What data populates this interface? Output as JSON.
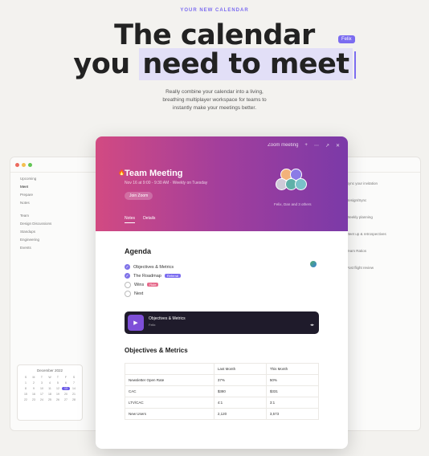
{
  "hero": {
    "eyebrow": "YOUR NEW CALENDAR",
    "line1": "The calendar",
    "line2_pre": "you",
    "line2_hl": "need to meet",
    "cursor_tag": "Felix",
    "sub": [
      "Really combine your calendar into a living,",
      "breathing multiplayer workspace for teams to",
      "instantly make your meetings better."
    ]
  },
  "sidebar": {
    "items": [
      "Upcoming",
      "Meet",
      "Prepare",
      "Notes",
      "Team",
      "Design Discussions",
      "Standups",
      "Engineering",
      "Events"
    ],
    "active_index": 1
  },
  "right_items": [
    "Sync your invitation",
    "Design/Sync",
    "Weekly planning",
    "Meet up & retrospectives",
    "Team Ratios",
    "Post flight review"
  ],
  "minical": {
    "title": "December 2022",
    "days": [
      "S",
      "M",
      "T",
      "W",
      "T",
      "F",
      "S",
      "1",
      "2",
      "3",
      "4",
      "5",
      "6",
      "7",
      "8",
      "9",
      "10",
      "11",
      "12",
      "13",
      "14",
      "15",
      "16",
      "17",
      "18",
      "19",
      "20",
      "21",
      "22",
      "23",
      "24",
      "25",
      "26",
      "27",
      "28"
    ],
    "selected": "13"
  },
  "card": {
    "topbar": [
      "Zoom meeting",
      "+",
      "⋯",
      "↗",
      "✕"
    ],
    "emoji": "🔥",
    "title": "Team Meeting",
    "meta": "Nov 16 at 9:00 - 9:30 AM · Weekly on Tuesday",
    "pill": "Join Zoom",
    "tabs": [
      "Notes",
      "Details"
    ],
    "avatars_label": "Felix, Dan and 3 others",
    "agenda_title": "Agenda",
    "agenda": [
      {
        "text": "Objectives & Metrics",
        "checked": true
      },
      {
        "text": "The Roadmap",
        "checked": true,
        "tag": "Referral"
      },
      {
        "text": "Wins",
        "checked": false,
        "tag": "Rule"
      },
      {
        "text": "Next",
        "checked": false
      }
    ],
    "player": {
      "title": "Objectives & Metrics",
      "sub": "Felix",
      "ctrl": "◂▸"
    },
    "objectives_title": "Objectives & Metrics",
    "table": {
      "headers": [
        "",
        "Last Month",
        "This Month"
      ],
      "rows": [
        [
          "Newsletter Open Rate",
          "37%",
          "50%"
        ],
        [
          "CAC",
          "$380",
          "$331"
        ],
        [
          "LTV/CAC",
          "4:1",
          "3:1"
        ],
        [
          "New Users",
          "2,120",
          "3,573"
        ]
      ]
    }
  }
}
